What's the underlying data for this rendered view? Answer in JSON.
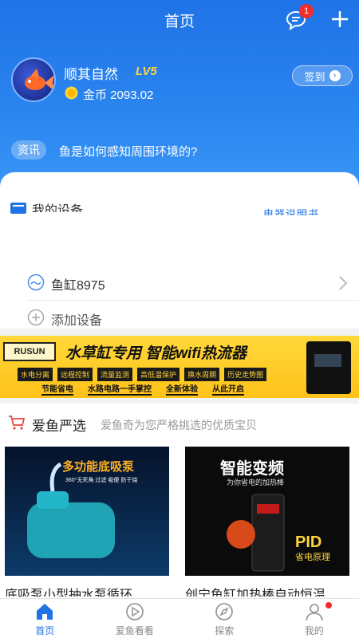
{
  "topbar": {
    "title": "首页",
    "message_badge": "1"
  },
  "profile": {
    "username": "顺其自然",
    "level": "LV5",
    "coins": "金币 2093.02",
    "signin_label": "签到"
  },
  "news": {
    "tag": "资讯",
    "headline": "鱼是如何感知周围环境的?"
  },
  "devices": {
    "section_title": "我的设备",
    "link": "电器说明书",
    "items": [
      {
        "name": "鱼缸8975"
      }
    ],
    "add_label": "添加设备"
  },
  "banner": {
    "logo": "RUSUN",
    "headline": "水草缸专用 智能wifi热流器",
    "tags": [
      "水电分离",
      "远程控制",
      "流量监测",
      "高低温保护",
      "换水周期",
      "历史走势图"
    ],
    "bottom": [
      "节能省电",
      "水路电路一手掌控",
      "全新体验",
      "从此开启"
    ]
  },
  "shop": {
    "title": "爱鱼严选",
    "subtitle": "爱鱼奇为您严格挑选的优质宝贝",
    "products": [
      {
        "name": "底吸泵小型抽水泵循环",
        "image_text": "多功能底吸泵",
        "image_sub": "360°无死角 过滤 吸便 防干烧"
      },
      {
        "name": "创宁鱼缸加热棒自动恒温",
        "image_text": "智能变频",
        "image_sub": "为你省电的加热棒",
        "image_badge": "PID",
        "image_badge_sub": "省电原理"
      }
    ]
  },
  "tabbar": {
    "items": [
      {
        "label": "首页",
        "active": true
      },
      {
        "label": "爱鱼看看",
        "active": false
      },
      {
        "label": "探索",
        "active": false
      },
      {
        "label": "我的",
        "active": false
      }
    ]
  },
  "colors": {
    "primary": "#1f73e6",
    "accent": "#ffc21a",
    "badge": "#f02c2c"
  }
}
